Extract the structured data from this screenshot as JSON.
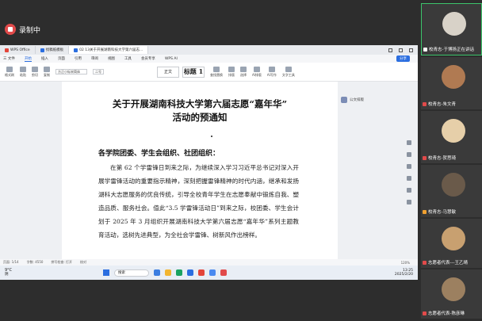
{
  "recording": {
    "label": "录制中"
  },
  "window": {
    "tabs": [
      {
        "label": "WPS Office",
        "color": "red"
      },
      {
        "label": "找稿纸模板",
        "color": "blue"
      },
      {
        "label": "02 13关于开展湖南科技大学第六届志...",
        "color": "blue"
      }
    ],
    "share_label": "分享"
  },
  "menu": {
    "items": [
      "三 文件",
      "开始",
      "插入",
      "页面",
      "引用",
      "审阅",
      "视图",
      "工具",
      "会员专享",
      "WPS AI"
    ],
    "active_index": 1
  },
  "ribbon": {
    "buttons": [
      "格式刷",
      "粘贴",
      "剪切",
      "复制"
    ],
    "font_value": "方正小标宋简体",
    "size_value": "二号",
    "styles": [
      {
        "label": "正文"
      },
      {
        "label": "标题 1"
      }
    ],
    "right_buttons": [
      "查找替换",
      "排版",
      "选择",
      "AI排版",
      "AI写作",
      "文字工具"
    ]
  },
  "document": {
    "title_line1": "关于开展湖南科技大学第六届志愿“嘉年华”",
    "title_line2": "活动的预通知",
    "salutation": "各学院团委、学生会组织、社团组织：",
    "body": "在第 62 个学雷锋日到来之际，为继续深入学习习近平总书记对深入开展学雷锋活动的重要指示精神，深刻把握雷锋精神的时代内涵，继承和发扬湖科大志愿服务的优良传统，引导全校青年学生在志愿奉献中锻炼自我、塑造品质、服务社会。值此“3.5 学雷锋活动日”到来之际，校团委、学生会计划于 2025 年 3 月组织开展湖南科技大学第六届志愿“嘉年华”系列主题教育活动，选树先进典型，为全社会学雷锋、树新风作出榜样。"
  },
  "side_panel": {
    "label": "公文排版"
  },
  "status": {
    "page": "页面: 1/14",
    "words": "字数: 4550",
    "spell": "拼写检查: 打开",
    "check": "校对",
    "zoom": "120%"
  },
  "taskbar": {
    "weather_temp": "9°C",
    "weather_desc": "阴",
    "search_placeholder": "搜索",
    "time": "13:25",
    "date": "2025/2/20"
  },
  "participants": [
    {
      "name": "校青志-于博扬正在讲话",
      "avatar_color": "#d8d2c8",
      "speaking": true,
      "muted": false
    },
    {
      "name": "校青志-朱文青",
      "avatar_color": "#b07a52",
      "speaking": false,
      "muted": true
    },
    {
      "name": "校青志-贺思琦",
      "avatar_color": "#e6cfa9",
      "speaking": false,
      "muted": true
    },
    {
      "name": "校青志-马慧敏",
      "avatar_color": "#6a5a4a",
      "speaking": false,
      "muted": false
    },
    {
      "name": "志愿者代表---王乙晴",
      "avatar_color": "#c8a070",
      "speaking": false,
      "muted": true
    },
    {
      "name": "志愿者代表-陈彦琳",
      "avatar_color": "#9c8060",
      "speaking": false,
      "muted": true
    }
  ]
}
